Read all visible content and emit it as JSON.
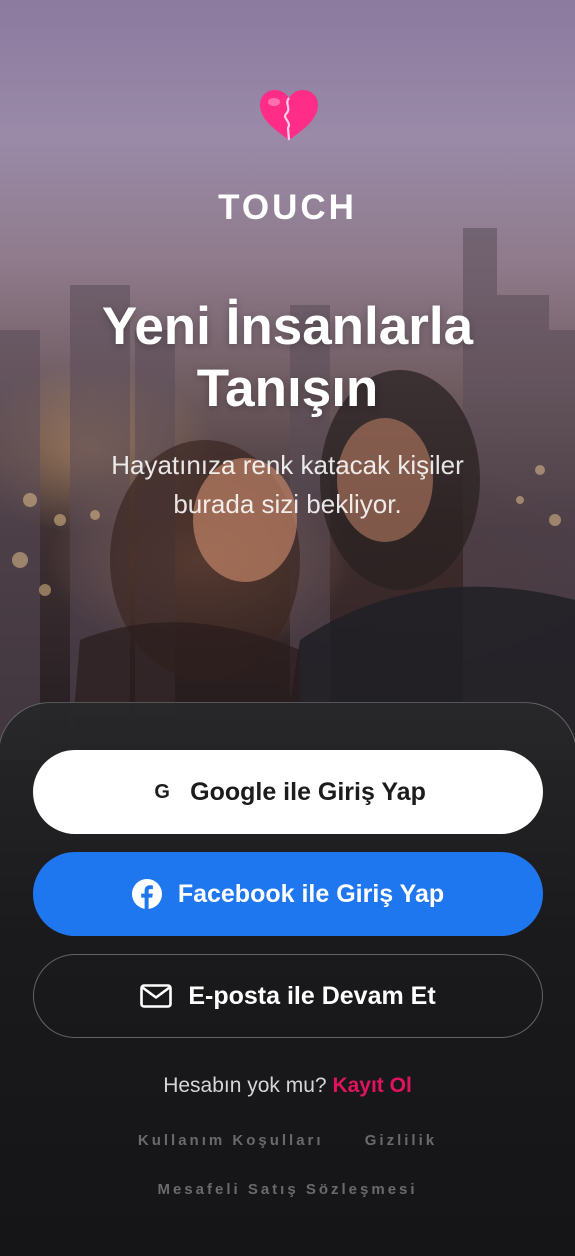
{
  "app": {
    "brand": "TOUCH",
    "headline_line1": "Yeni İnsanlarla",
    "headline_line2": "Tanışın",
    "subhead_line1": "Hayatınıza renk katacak kişiler",
    "subhead_line2": "burada sizi bekliyor."
  },
  "icons": {
    "logo": "heart-puzzle-icon",
    "google": "google-g-icon",
    "facebook": "facebook-icon",
    "email": "mail-envelope-icon"
  },
  "buttons": {
    "google_label": "Google ile Giriş Yap",
    "google_glyph": "G",
    "facebook_label": "Facebook ile Giriş Yap",
    "email_label": "E-posta ile Devam Et"
  },
  "signup": {
    "prompt": "Hesabın yok mu?",
    "link": "Kayıt Ol"
  },
  "legal": {
    "terms": "Kullanım Koşulları",
    "privacy": "Gizlilik",
    "sales_contract": "Mesafeli Satış Sözleşmesi"
  },
  "colors": {
    "accent": "#e0135e",
    "facebook_blue": "#1f77f0",
    "sheet_background": "#141416",
    "heart_pink": "#ff2d87"
  }
}
